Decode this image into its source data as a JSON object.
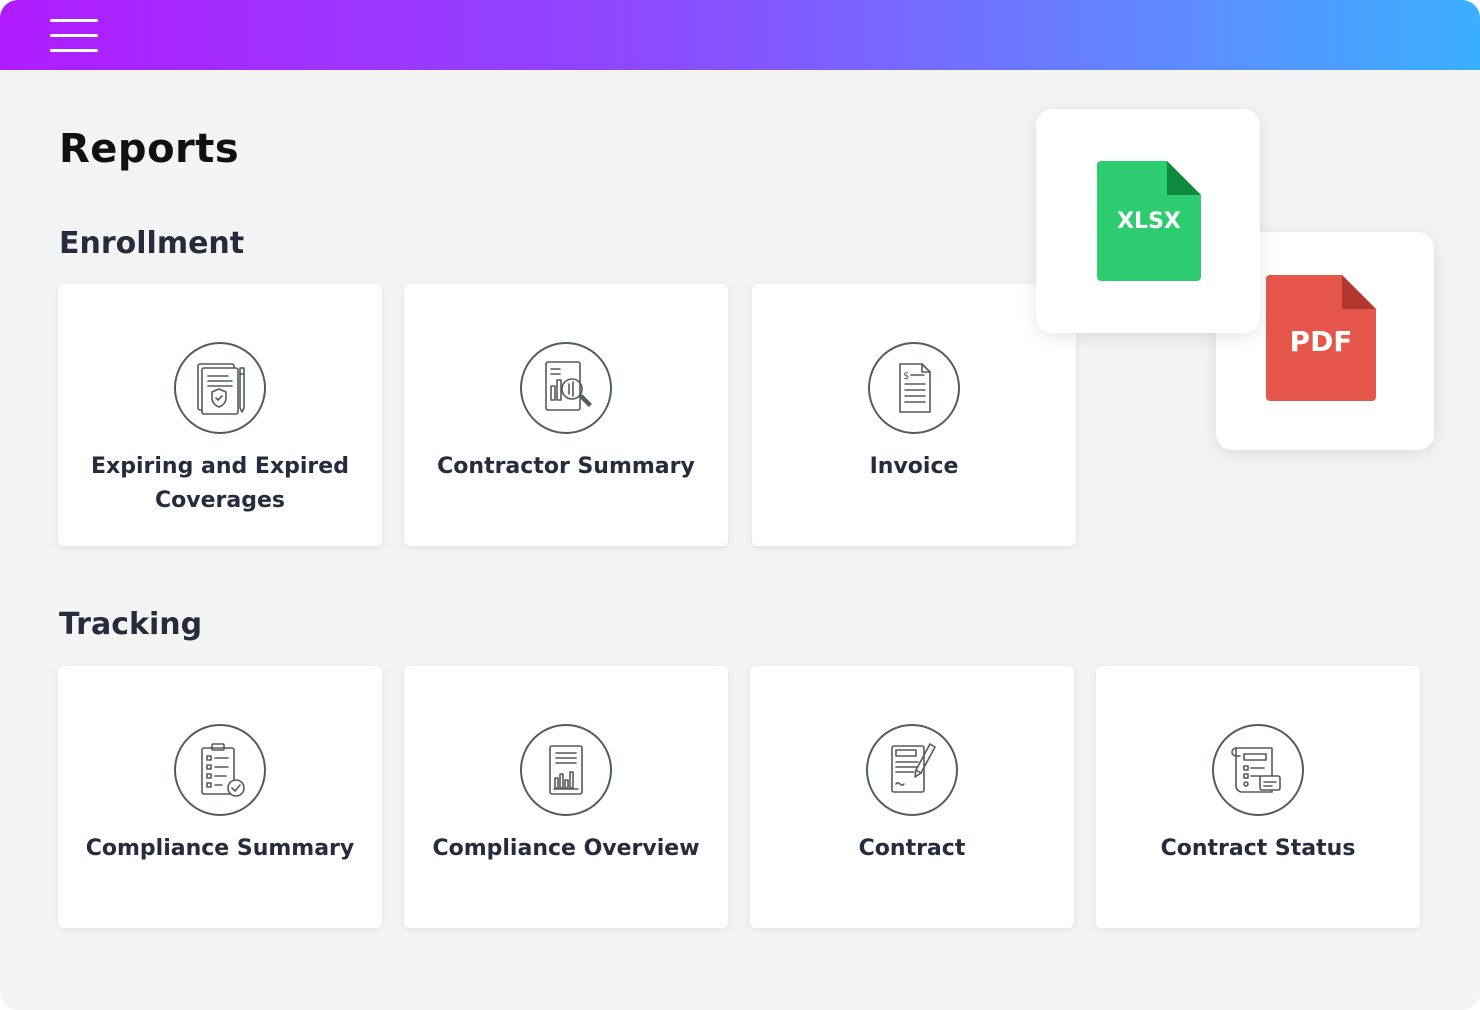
{
  "header": {
    "menu_icon": "hamburger-menu-icon",
    "gradient": [
      "#b01cff",
      "#3aafff"
    ]
  },
  "page": {
    "title": "Reports"
  },
  "sections": [
    {
      "title": "Enrollment",
      "cards": [
        {
          "label": "Expiring and Expired Coverages",
          "icon": "shield-document-icon"
        },
        {
          "label": "Contractor Summary",
          "icon": "magnify-report-icon"
        },
        {
          "label": "Invoice",
          "icon": "invoice-icon"
        }
      ]
    },
    {
      "title": "Tracking",
      "cards": [
        {
          "label": "Compliance Summary",
          "icon": "checklist-icon"
        },
        {
          "label": "Compliance Overview",
          "icon": "bar-chart-document-icon"
        },
        {
          "label": "Contract",
          "icon": "signed-contract-icon"
        },
        {
          "label": "Contract Status",
          "icon": "contract-status-icon"
        }
      ]
    }
  ],
  "exports": [
    {
      "label": "XLSX",
      "color": "#2ecc71",
      "fold_color": "#0e8a3c"
    },
    {
      "label": "PDF",
      "color": "#e5574b",
      "fold_color": "#b1372c"
    }
  ]
}
